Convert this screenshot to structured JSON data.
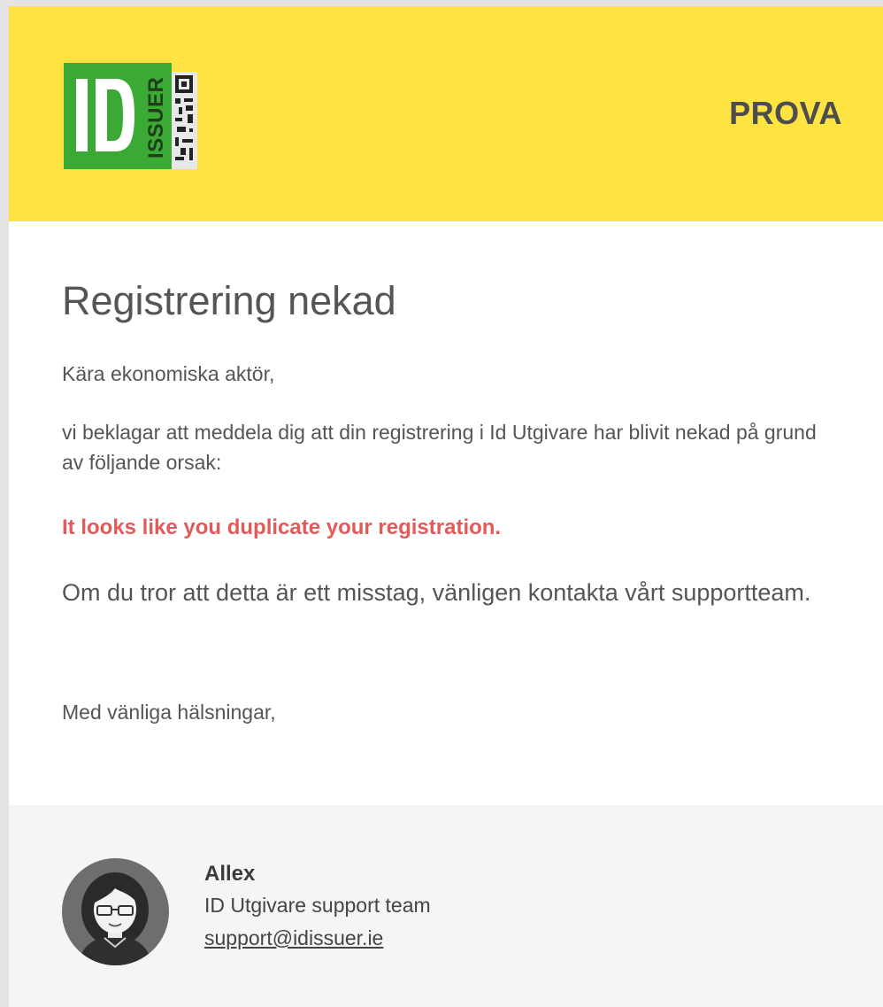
{
  "header": {
    "logo_text": "ID",
    "logo_subtext": "ISSUER",
    "right_label": "PROVA",
    "colors": {
      "header_bg": "#ffe343",
      "logo_green": "#3aaa35"
    }
  },
  "content": {
    "title": "Registrering nekad",
    "greeting": "Kära ekonomiska aktör,",
    "message": "vi beklagar att meddela dig att din registrering i Id Utgivare har blivit nekad på grund av följande orsak:",
    "reason": "It looks like you duplicate your registration.",
    "contact": "Om du tror att detta är ett misstag, vänligen kontakta vårt supportteam.",
    "closing": "Med vänliga hälsningar,",
    "colors": {
      "reason": "#e35a5a",
      "text": "#555555"
    }
  },
  "footer": {
    "avatar_icon": "woman-avatar-icon",
    "name": "Allex",
    "team": "ID Utgivare support team",
    "email": "support@idissuer.ie"
  }
}
